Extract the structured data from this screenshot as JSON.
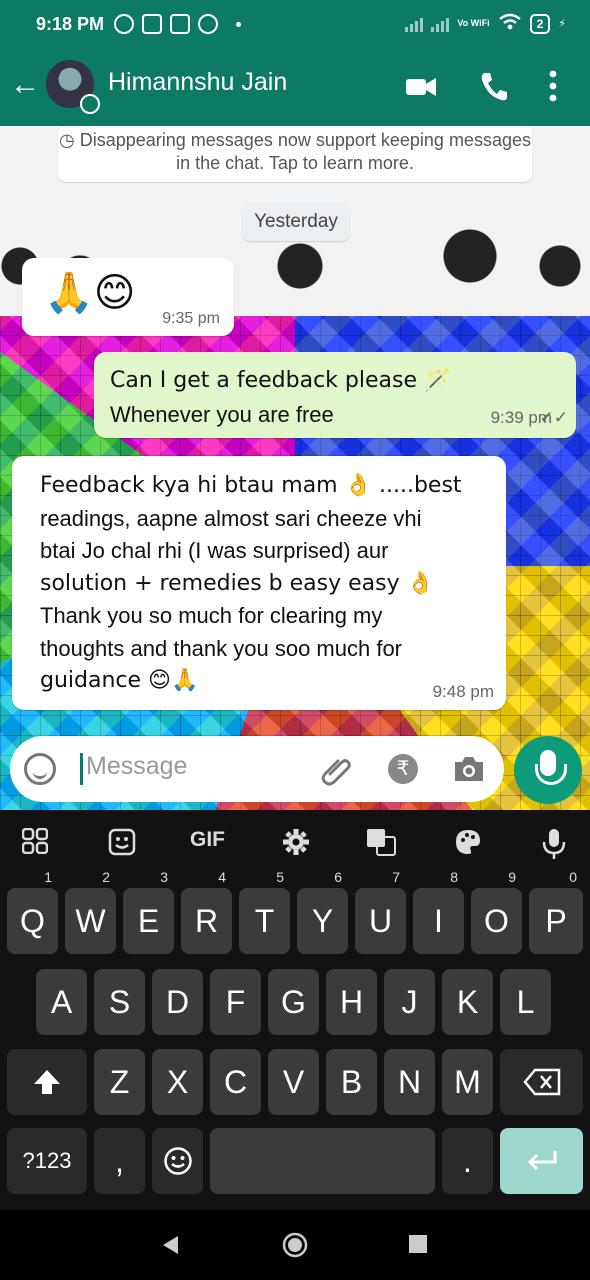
{
  "status_bar": {
    "time": "9:18 PM",
    "network": "Vo WiFi",
    "battery": "2"
  },
  "header": {
    "contact_name": "Himannshu Jain"
  },
  "chat": {
    "notice": "Disappearing messages now support keeping messages in the chat. Tap to learn more.",
    "date_divider": "Yesterday",
    "messages": [
      {
        "direction": "in",
        "text": "🙏😊",
        "time": "9:35 pm"
      },
      {
        "direction": "out",
        "lines": [
          "Can I get a feedback please 🪄",
          "Whenever you are free"
        ],
        "time": "9:39 pm",
        "ticks": "✓✓"
      },
      {
        "direction": "in",
        "lines": [
          "Feedback kya hi btau mam 👌 .....best",
          "readings, aapne almost sari cheeze vhi",
          "btai Jo chal rhi (I was surprised) aur",
          "solution + remedies b easy easy 👌",
          "Thank you so much for clearing my",
          "thoughts and thank you soo much for",
          "guidance 😊🙏"
        ],
        "time": "9:48 pm"
      }
    ]
  },
  "composer": {
    "placeholder": "Message",
    "payment_symbol": "₹"
  },
  "keyboard": {
    "toolbar": {
      "gif": "GIF"
    },
    "row1": [
      {
        "key": "Q",
        "hint": "1"
      },
      {
        "key": "W",
        "hint": "2"
      },
      {
        "key": "E",
        "hint": "3"
      },
      {
        "key": "R",
        "hint": "4"
      },
      {
        "key": "T",
        "hint": "5"
      },
      {
        "key": "Y",
        "hint": "6"
      },
      {
        "key": "U",
        "hint": "7"
      },
      {
        "key": "I",
        "hint": "8"
      },
      {
        "key": "O",
        "hint": "9"
      },
      {
        "key": "P",
        "hint": "0"
      }
    ],
    "row2": [
      "A",
      "S",
      "D",
      "F",
      "G",
      "H",
      "J",
      "K",
      "L"
    ],
    "row3": [
      "Z",
      "X",
      "C",
      "V",
      "B",
      "N",
      "M"
    ],
    "symbols": "?123",
    "comma": ",",
    "period": "."
  },
  "colors": {
    "brand": "#0d7b63",
    "outgoing_bubble": "#e1f7cb",
    "mic_button": "#0d9b7a",
    "enter_key": "#9fd6cc"
  },
  "icons": [
    "back-arrow-icon",
    "video-call-icon",
    "voice-call-icon",
    "more-vert-icon",
    "emoji-icon",
    "attach-icon",
    "rupee-icon",
    "camera-icon",
    "mic-icon"
  ]
}
